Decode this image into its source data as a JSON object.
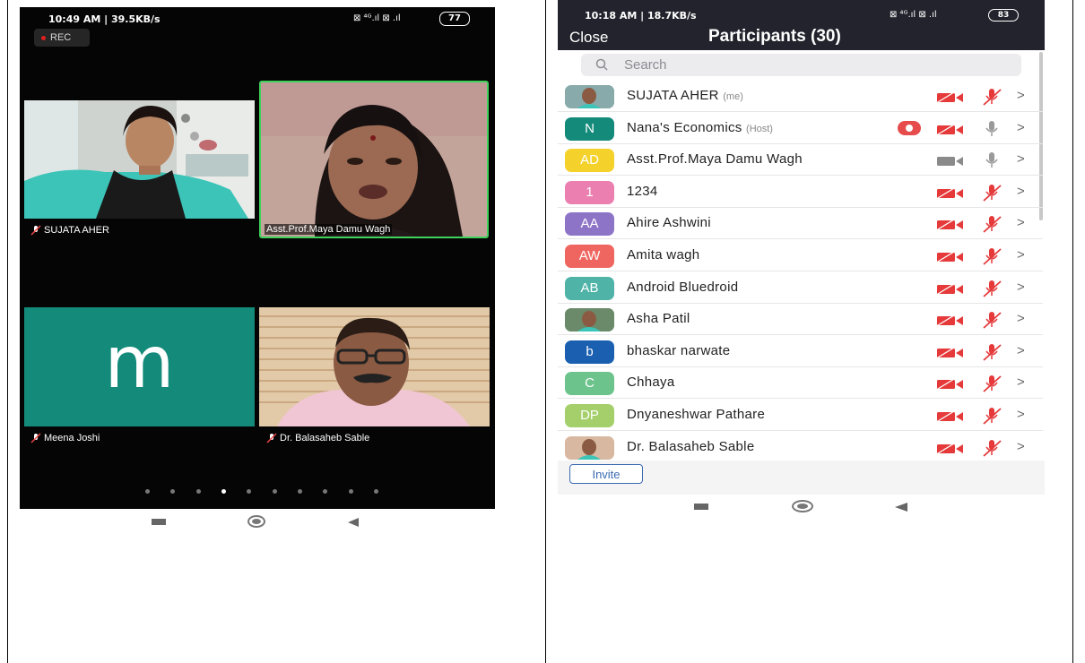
{
  "left_phone": {
    "status_time": "10:49 AM | 39.5KB/s",
    "status_right": "⊠ ⁴ᴳ.ıl ⊠ .ıl",
    "battery": "77",
    "rec_label": "REC",
    "tiles": [
      {
        "name": "SUJATA AHER",
        "muted": true,
        "type": "video"
      },
      {
        "name": "Asst.Prof.Maya Damu Wagh",
        "muted": false,
        "type": "video",
        "active_speaker": true
      },
      {
        "name": "Meena Joshi",
        "muted": true,
        "type": "avatar",
        "letter": "m"
      },
      {
        "name": "Dr. Balasaheb Sable",
        "muted": true,
        "type": "video"
      }
    ],
    "page_dots": 10,
    "active_dot": 3
  },
  "right_phone": {
    "status_time": "10:18 AM | 18.7KB/s",
    "status_right": "⊠ ⁴ᴳ.ıl ⊠ .ıl",
    "battery": "83",
    "close_label": "Close",
    "title": "Participants (30)",
    "search_placeholder": "Search",
    "invite_label": "Invite",
    "participants": [
      {
        "name": "SUJATA AHER",
        "tag": "(me)",
        "avatar": "photo",
        "color": "#8aa",
        "video_off": true,
        "mic_off": true
      },
      {
        "name": "Nana's Economics",
        "tag": "(Host)",
        "avatar": "N",
        "color": "#138a7a",
        "recording": true,
        "video_off": true,
        "mic_off": false
      },
      {
        "name": "Asst.Prof.Maya Damu Wagh",
        "tag": "",
        "avatar": "AD",
        "color": "#f5d22b",
        "video_off": false,
        "mic_off": false
      },
      {
        "name": "1234",
        "tag": "",
        "avatar": "1",
        "color": "#ea7fb0",
        "video_off": true,
        "mic_off": true
      },
      {
        "name": "Ahire Ashwini",
        "tag": "",
        "avatar": "AA",
        "color": "#8d74c7",
        "video_off": true,
        "mic_off": true
      },
      {
        "name": "Amita wagh",
        "tag": "",
        "avatar": "AW",
        "color": "#ef6560",
        "video_off": true,
        "mic_off": true
      },
      {
        "name": "Android Bluedroid",
        "tag": "",
        "avatar": "AB",
        "color": "#4fb3a8",
        "video_off": true,
        "mic_off": true
      },
      {
        "name": "Asha Patil",
        "tag": "",
        "avatar": "photo",
        "color": "#6a8a6a",
        "video_off": true,
        "mic_off": true
      },
      {
        "name": "bhaskar narwate",
        "tag": "",
        "avatar": "b",
        "color": "#1a5fb0",
        "video_off": true,
        "mic_off": true
      },
      {
        "name": "Chhaya",
        "tag": "",
        "avatar": "C",
        "color": "#6cc48c",
        "video_off": true,
        "mic_off": true
      },
      {
        "name": "Dnyaneshwar Pathare",
        "tag": "",
        "avatar": "DP",
        "color": "#a4cf6a",
        "video_off": true,
        "mic_off": true
      },
      {
        "name": "Dr. Balasaheb Sable",
        "tag": "",
        "avatar": "photo",
        "color": "#d8b8a0",
        "video_off": true,
        "mic_off": true
      }
    ]
  }
}
